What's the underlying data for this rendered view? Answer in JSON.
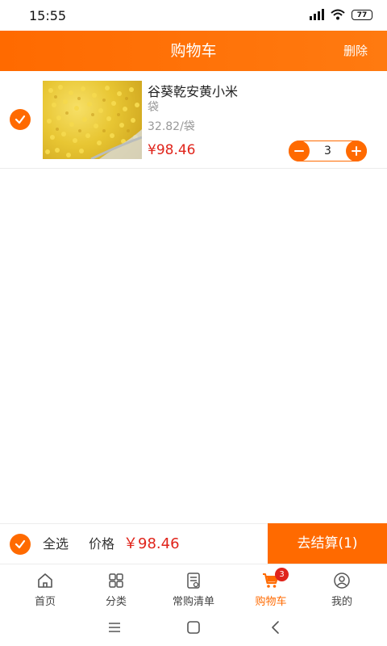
{
  "status_bar": {
    "time": "15:55",
    "battery": "77"
  },
  "header": {
    "title": "购物车",
    "delete_label": "删除"
  },
  "cart_item": {
    "name": "谷葵乾安黄小米",
    "unit": "袋",
    "unit_price": "32.82/袋",
    "total": "¥98.46",
    "quantity": "3",
    "selected": true
  },
  "bottom_bar": {
    "select_all_label": "全选",
    "price_label": "价格",
    "price_value": "￥98.46",
    "checkout_label": "去结算(1)"
  },
  "tab_bar": {
    "items": [
      {
        "label": "首页",
        "icon": "home-icon"
      },
      {
        "label": "分类",
        "icon": "grid-icon"
      },
      {
        "label": "常购清单",
        "icon": "list-icon"
      },
      {
        "label": "购物车",
        "icon": "cart-icon",
        "active": true,
        "badge": "3"
      },
      {
        "label": "我的",
        "icon": "user-icon"
      }
    ]
  },
  "colors": {
    "accent": "#ff6a00",
    "price": "#e0241b"
  }
}
